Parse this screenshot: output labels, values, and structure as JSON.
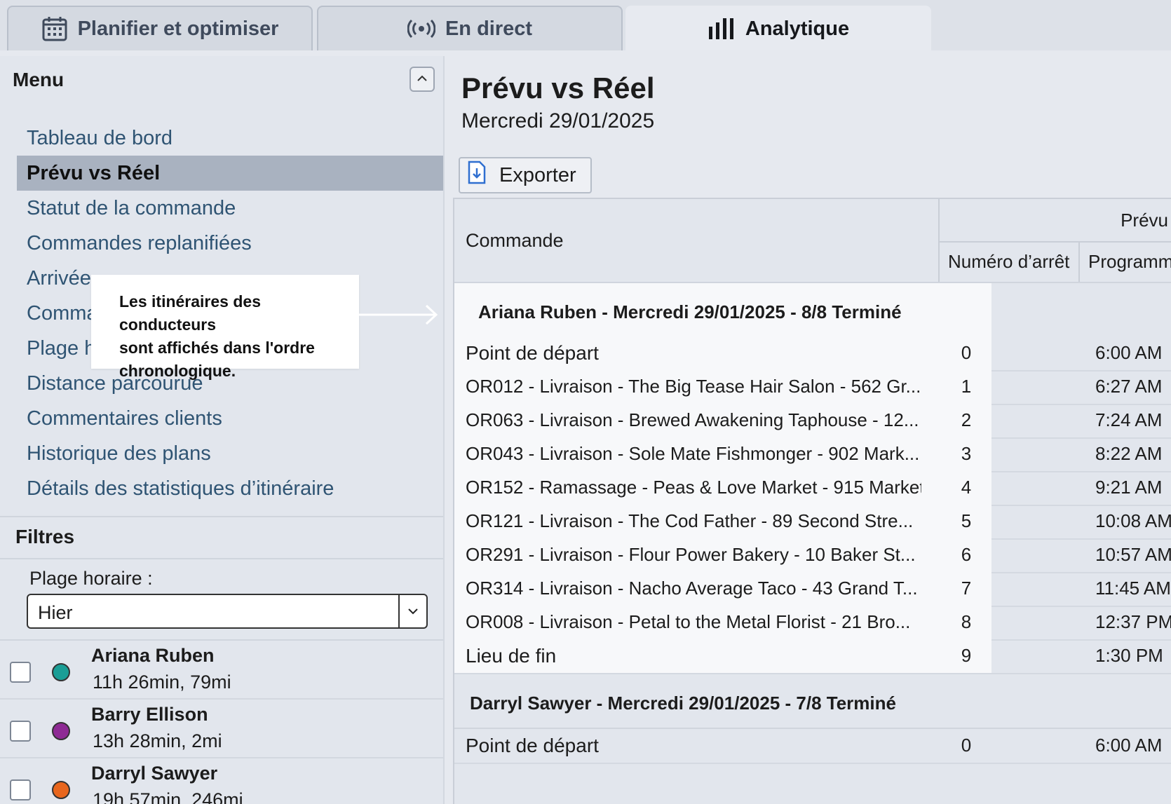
{
  "tabs": [
    {
      "label": "Planifier et optimiser",
      "icon": "calendar-icon"
    },
    {
      "label": "En direct",
      "icon": "broadcast-icon"
    },
    {
      "label": "Analytique",
      "icon": "bar-chart-icon",
      "active": true
    }
  ],
  "sidebar": {
    "menu_title": "Menu",
    "items": [
      {
        "label": "Tableau de bord"
      },
      {
        "label": "Prévu vs Réel",
        "active": true
      },
      {
        "label": "Statut de la commande"
      },
      {
        "label": "Commandes replanifiées"
      },
      {
        "label": "Arrivée"
      },
      {
        "label": "Comma"
      },
      {
        "label": "Plage h"
      },
      {
        "label": "Distance parcourue"
      },
      {
        "label": "Commentaires clients"
      },
      {
        "label": "Historique des plans"
      },
      {
        "label": "Détails des statistiques d’itinéraire"
      }
    ],
    "filters_title": "Filtres",
    "time_range_label": "Plage horaire :",
    "time_range_value": "Hier",
    "drivers": [
      {
        "name": "Ariana Ruben",
        "stats": "11h 26min, 79mi",
        "color": "#1a9e96"
      },
      {
        "name": "Barry Ellison",
        "stats": "13h 28min, 2mi",
        "color": "#8e2a94"
      },
      {
        "name": "Darryl Sawyer",
        "stats": "19h 57min, 246mi",
        "color": "#e8661d"
      }
    ]
  },
  "tooltip": {
    "lines": [
      "Les itinéraires des conducteurs",
      "sont affichés dans l'ordre",
      "chronologique."
    ]
  },
  "main": {
    "title": "Prévu vs Réel",
    "date": "Mercredi 29/01/2025",
    "export_label": "Exporter",
    "table": {
      "col_commande": "Commande",
      "col_group_prevu": "Prévu",
      "col_num_arret": "Numéro d’arrêt",
      "col_programme": "Programm",
      "groups": [
        {
          "header": "Ariana Ruben - Mercredi 29/01/2025 - 8/8 Terminé",
          "rows": [
            {
              "order": "Point de départ",
              "stop": "0",
              "time": "6:00 AM"
            },
            {
              "order": "OR012 - Livraison - The Big Tease Hair Salon - 562 Gr...",
              "stop": "1",
              "time": "6:27 AM"
            },
            {
              "order": "OR063 - Livraison - Brewed Awakening Taphouse - 12...",
              "stop": "2",
              "time": "7:24 AM"
            },
            {
              "order": "OR043 - Livraison - Sole Mate Fishmonger - 902 Mark...",
              "stop": "3",
              "time": "8:22 AM"
            },
            {
              "order": "OR152 - Ramassage - Peas & Love Market - 915 Market ...",
              "stop": "4",
              "time": "9:21 AM"
            },
            {
              "order": "OR121 - Livraison - The Cod Father - 89 Second Stre...",
              "stop": "5",
              "time": "10:08 AM"
            },
            {
              "order": "OR291 - Livraison - Flour Power Bakery - 10 Baker St...",
              "stop": "6",
              "time": "10:57 AM"
            },
            {
              "order": "OR314 - Livraison - Nacho Average Taco - 43 Grand T...",
              "stop": "7",
              "time": "11:45 AM"
            },
            {
              "order": "OR008 - Livraison - Petal to the Metal Florist - 21 Bro...",
              "stop": "8",
              "time": "12:37 PM"
            },
            {
              "order": "Lieu de fin",
              "stop": "9",
              "time": "1:30 PM"
            }
          ]
        },
        {
          "header": "Darryl Sawyer - Mercredi 29/01/2025 - 7/8 Terminé",
          "rows": [
            {
              "order": "Point de départ",
              "stop": "0",
              "time": "6:00 AM"
            }
          ]
        }
      ]
    }
  }
}
